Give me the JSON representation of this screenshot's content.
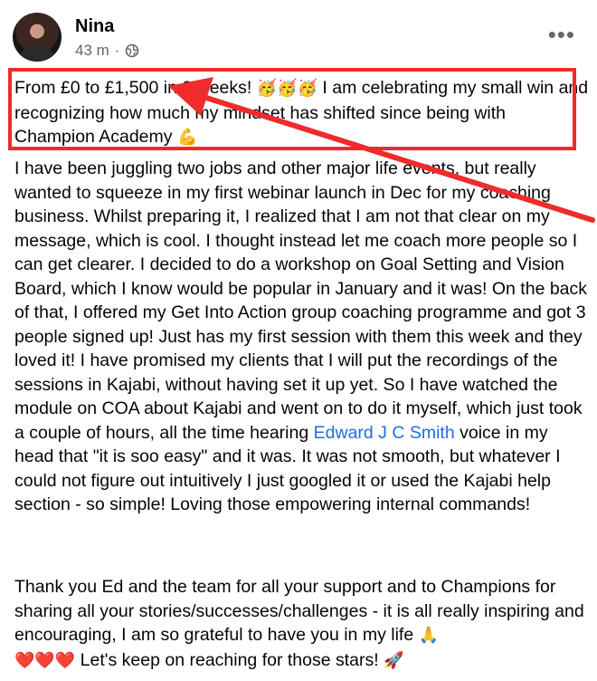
{
  "post": {
    "author": "Nina",
    "time": "43 m",
    "privacy_icon": "globe-icon",
    "more_icon": "more-options-icon",
    "more_glyph": "•••",
    "highlight_text_a": "From £0 to £1,500 in 2 weeks! ",
    "highlight_emoji_1": "🥳🥳🥳",
    "highlight_text_b": "  I am celebrating my small win and recognizing how much my mindset has shifted since being with Champion Academy ",
    "highlight_emoji_2": "💪",
    "body_a": "I have been juggling two jobs and other major life events, but really wanted to squeeze in my first webinar launch in Dec for my coaching business. Whilst preparing it, I realized that I am not that clear on my message, which is cool. I thought instead let me coach more people so I can get clearer. I decided to do a workshop on Goal Setting and Vision Board, which I know would be popular in January and it was! On the back of that, I offered my Get Into Action group coaching programme and got 3 people signed up! Just has my first session with them this week and they loved it! I have promised my clients that I will put the recordings of the sessions in Kajabi, without having set it up yet. So I have watched the module on COA about Kajabi and went on to do it myself, which just took a couple of hours, all the time hearing ",
    "mention": "Edward J C Smith",
    "body_b": " voice in my head that \"it is soo easy\" and it was. It was not smooth, but whatever I could not figure out intuitively I just googled it or used the Kajabi help section - so simple! Loving those empowering internal commands!",
    "closing_a": "Thank you Ed and the team for all your support and to Champions for sharing all your stories/successes/challenges - it is all really inspiring and encouraging, I am so grateful to have you in my life ",
    "closing_emoji_1": "🙏",
    "closing_hearts": "❤️❤️❤️",
    "closing_b": "  Let's keep on reaching for those stars! ",
    "closing_emoji_2": "🚀"
  },
  "colors": {
    "annotation_red": "#ef2b2b",
    "link_blue": "#216fdb",
    "meta_gray": "#65676b"
  }
}
